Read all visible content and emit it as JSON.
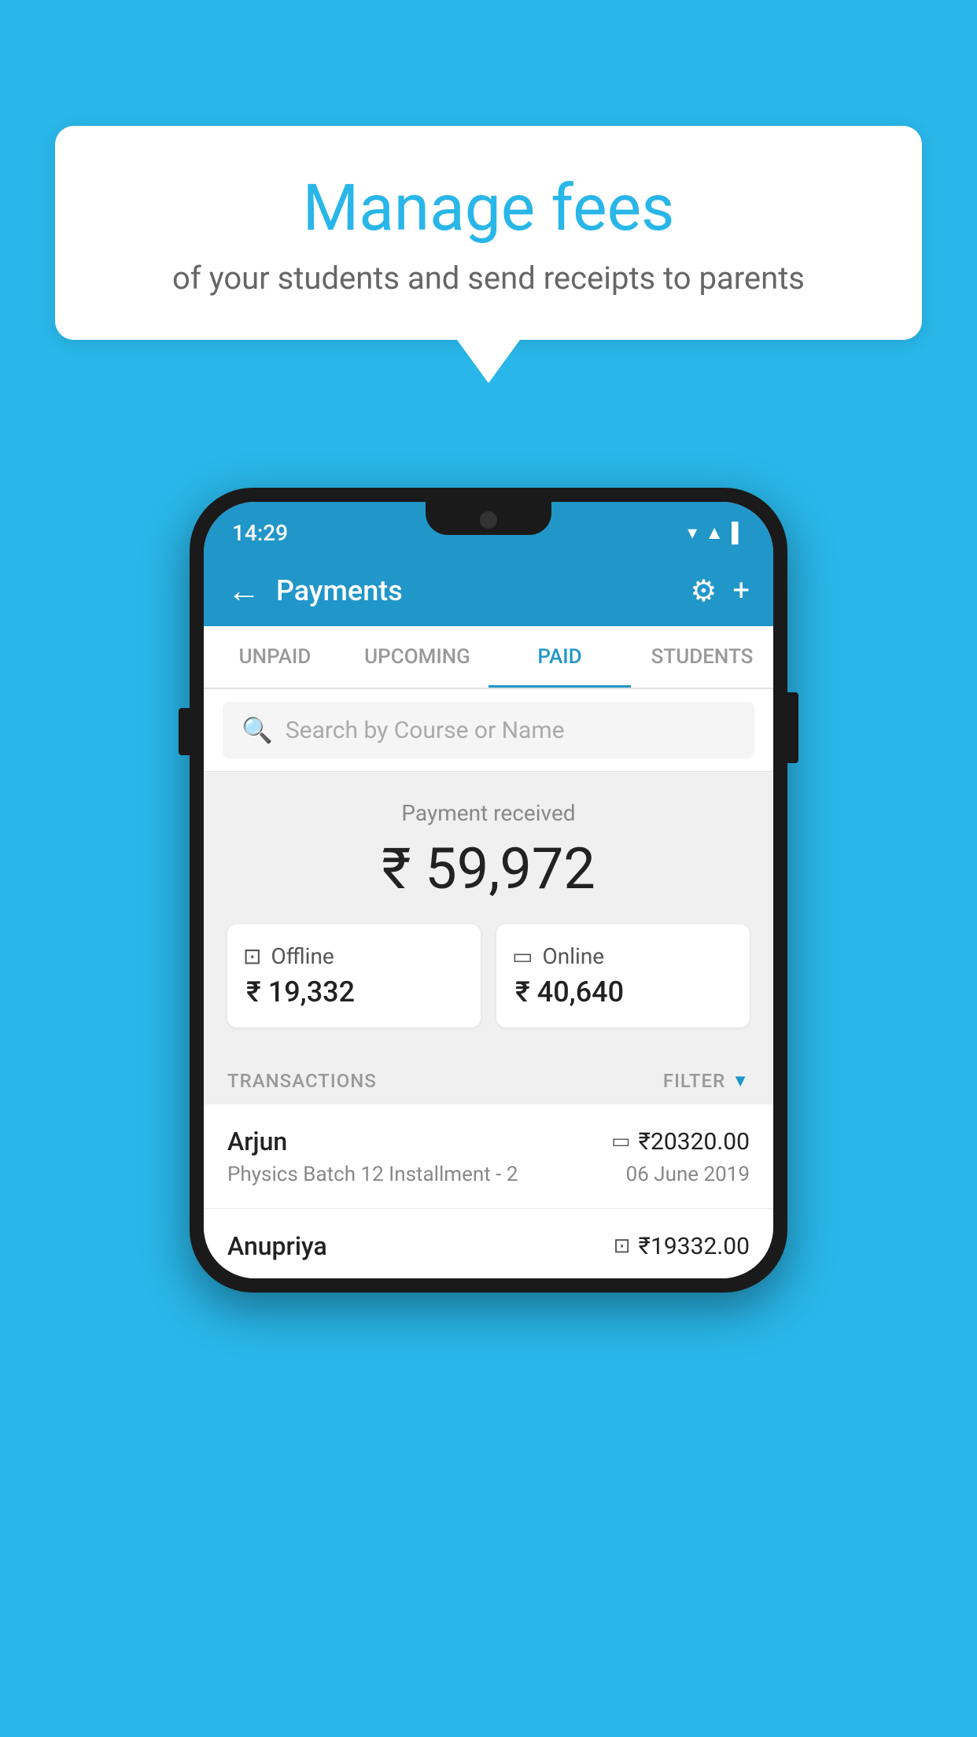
{
  "background_color": "#29b6e8",
  "speech_bubble": {
    "title": "Manage fees",
    "subtitle": "of your students and send receipts to parents"
  },
  "status_bar": {
    "time": "14:29",
    "wifi": "▾",
    "signal": "▾",
    "battery": "▌"
  },
  "app_header": {
    "title": "Payments",
    "back_label": "←",
    "gear_label": "⚙",
    "plus_label": "+"
  },
  "tabs": [
    {
      "id": "unpaid",
      "label": "UNPAID",
      "active": false
    },
    {
      "id": "upcoming",
      "label": "UPCOMING",
      "active": false
    },
    {
      "id": "paid",
      "label": "PAID",
      "active": true
    },
    {
      "id": "students",
      "label": "STUDENTS",
      "active": false
    }
  ],
  "search": {
    "placeholder": "Search by Course or Name"
  },
  "payment_received": {
    "label": "Payment received",
    "total": "₹ 59,972",
    "offline": {
      "type": "Offline",
      "amount": "₹ 19,332"
    },
    "online": {
      "type": "Online",
      "amount": "₹ 40,640"
    }
  },
  "transactions": {
    "label": "TRANSACTIONS",
    "filter_label": "FILTER",
    "items": [
      {
        "name": "Arjun",
        "course": "Physics Batch 12 Installment - 2",
        "amount": "₹20320.00",
        "date": "06 June 2019",
        "payment_type": "card"
      },
      {
        "name": "Anupriya",
        "course": "",
        "amount": "₹19332.00",
        "date": "",
        "payment_type": "offline"
      }
    ]
  }
}
